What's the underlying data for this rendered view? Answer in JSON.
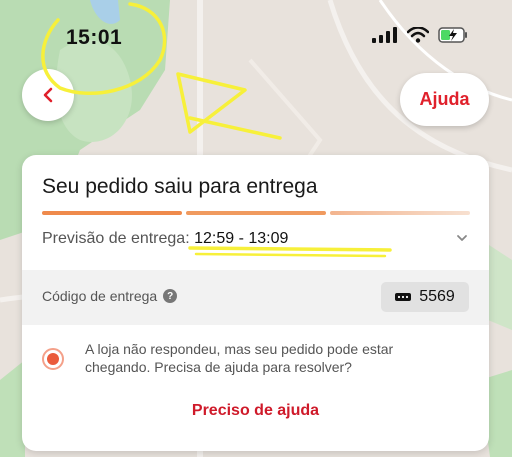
{
  "status_bar": {
    "time": "15:01"
  },
  "header": {
    "back_icon": "chevron-left-icon",
    "help_label": "Ajuda"
  },
  "order": {
    "title": "Seu pedido saiu para entrega",
    "progress_colors": [
      "#ef8a4c",
      "#f09a5f",
      "#f6d2bb"
    ],
    "forecast_label": "Previsão de entrega:",
    "forecast_value": "12:59 - 13:09"
  },
  "delivery_code": {
    "label": "Código de entrega",
    "code": "5569"
  },
  "alert": {
    "message": "A loja não respondeu, mas seu pedido pode estar chegando. Precisa de ajuda para resolver?",
    "action_label": "Preciso de ajuda"
  },
  "colors": {
    "brand_red": "#e0202b",
    "annotation_yellow": "#f7f03a"
  }
}
